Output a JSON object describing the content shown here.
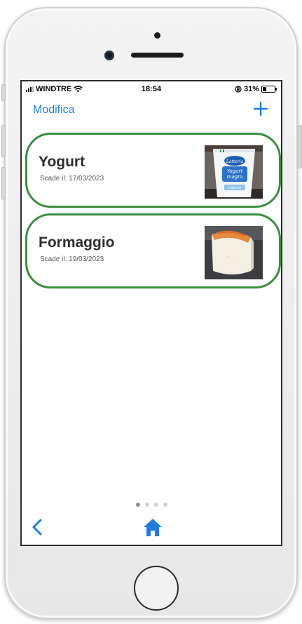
{
  "status_bar": {
    "carrier": "WINDTRE",
    "time": "18:54",
    "battery": "31%",
    "wifi_icon": "wifi-icon",
    "lock_icon": "orientation-lock-icon"
  },
  "nav": {
    "edit_label": "Modifica",
    "add_icon": "plus-icon"
  },
  "items": [
    {
      "name": "Yogurt",
      "expiry": "Scade il: 17/03/2023",
      "image": "yogurt-photo",
      "photo_text": {
        "brand": "Latteria",
        "line1": "Yogurt",
        "line2": "magro",
        "flavor": "bianco"
      }
    },
    {
      "name": "Formaggio",
      "expiry": "Scade il: 19/03/2023",
      "image": "cheese-photo"
    }
  ],
  "pager": {
    "pages": 4,
    "current": 1
  },
  "toolbar": {
    "back_icon": "chevron-left-icon",
    "home_icon": "home-icon"
  },
  "colors": {
    "accent": "#1e7ce0",
    "card_border": "#3a8f3f"
  }
}
